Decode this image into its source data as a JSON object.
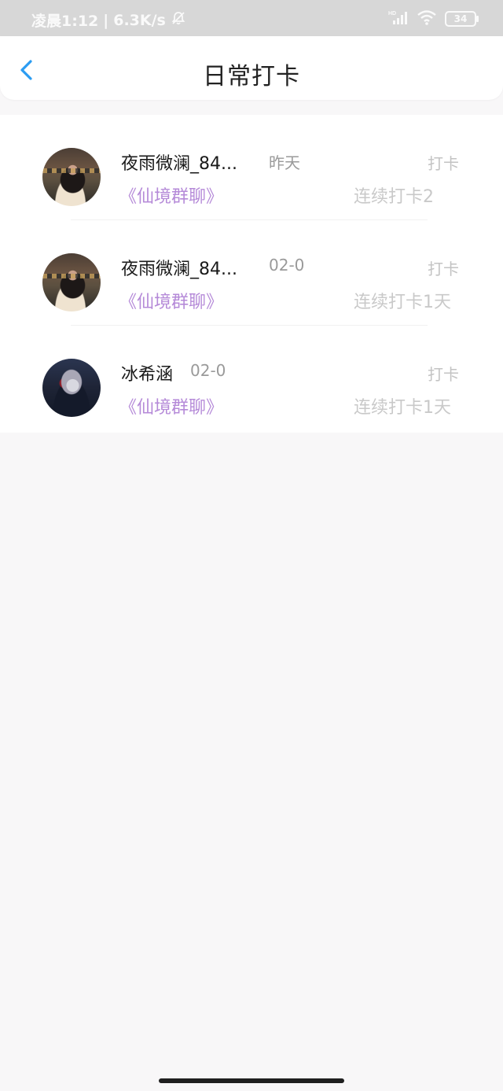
{
  "status_bar": {
    "time": "凌晨1:12",
    "speed": "6.3K/s",
    "battery": "34",
    "icons": [
      "bell-off-icon",
      "hd-signal-icon",
      "wifi-icon",
      "battery-icon"
    ]
  },
  "header": {
    "back_icon": "chevron-left-icon",
    "title": "日常打卡",
    "accent_color": "#2b9cf2"
  },
  "list": {
    "items": [
      {
        "name": "夜雨微澜_84...",
        "date": "昨天",
        "group": "《仙境群聊》",
        "action": "打卡",
        "streak": "连续打卡2",
        "avatar": "girl-photo-avatar"
      },
      {
        "name": "夜雨微澜_84...",
        "date": "02-0",
        "group": "《仙境群聊》",
        "action": "打卡",
        "streak": "连续打卡1天",
        "avatar": "girl-photo-avatar"
      },
      {
        "name": "冰希涵",
        "date": "02-0",
        "group": "《仙境群聊》",
        "action": "打卡",
        "streak": "连续打卡1天",
        "avatar": "anime-character-avatar"
      }
    ]
  },
  "colors": {
    "group_text": "#b58ad8",
    "status_bar_bg": "#d7d7d7",
    "page_bg": "#f8f7f8"
  }
}
